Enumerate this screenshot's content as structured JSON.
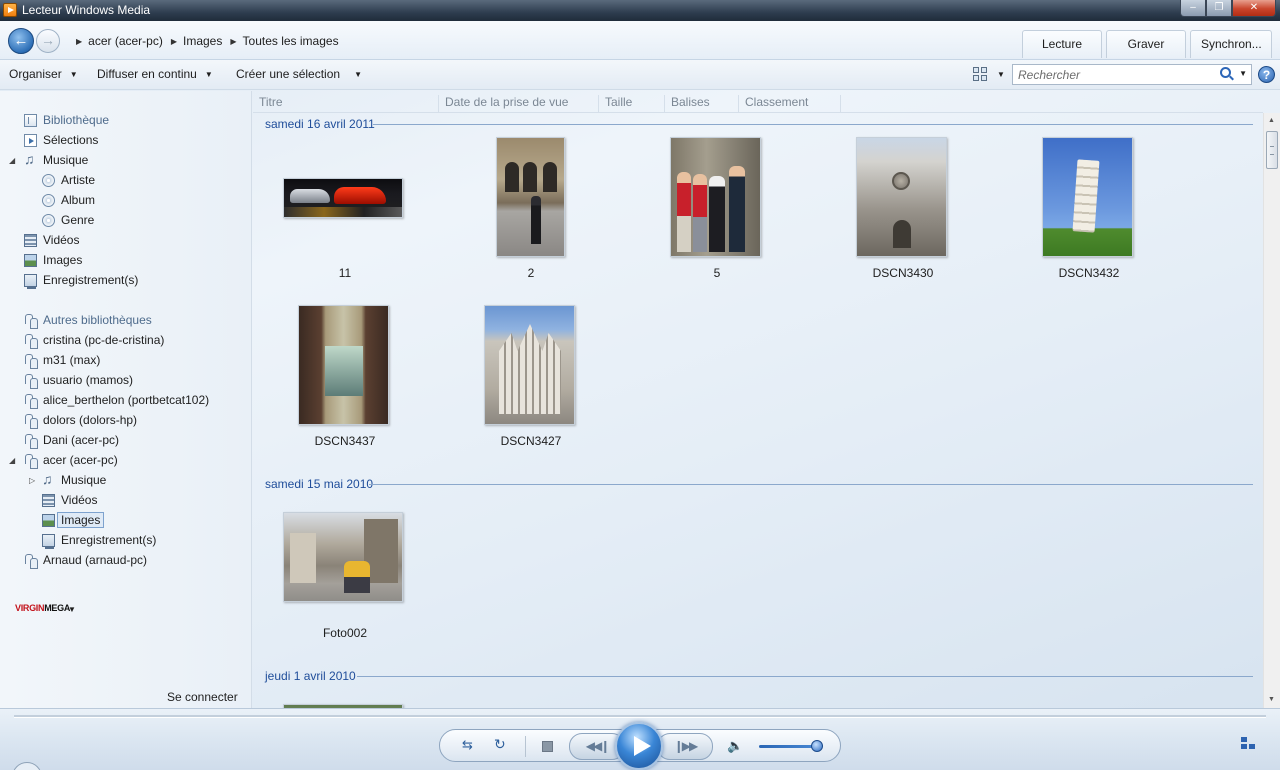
{
  "window": {
    "title": "Lecteur Windows Media"
  },
  "nav": {
    "breadcrumb": [
      "acer (acer-pc)",
      "Images",
      "Toutes les images"
    ],
    "tabs": [
      "Lecture",
      "Graver",
      "Synchron..."
    ]
  },
  "commands": {
    "organize": "Organiser",
    "stream": "Diffuser en continu",
    "create_playlist": "Créer une sélection",
    "search_placeholder": "Rechercher",
    "help": "?"
  },
  "sidebar": {
    "library": {
      "label": "Bibliothèque",
      "items": {
        "selections": "Sélections",
        "music": "Musique",
        "artist": "Artiste",
        "album": "Album",
        "genre": "Genre",
        "videos": "Vidéos",
        "images": "Images",
        "recordings": "Enregistrement(s)"
      }
    },
    "other_libraries": {
      "label": "Autres bibliothèques",
      "items": [
        "cristina (pc-de-cristina)",
        "m31 (max)",
        "usuario (mamos)",
        "alice_berthelon (portbetcat102)",
        "dolors (dolors-hp)",
        "Dani (acer-pc)",
        "acer (acer-pc)",
        "Arnaud (arnaud-pc)"
      ]
    },
    "acer_children": {
      "music": "Musique",
      "videos": "Vidéos",
      "images": "Images",
      "recordings": "Enregistrement(s)"
    },
    "store": {
      "virgin": "VIRGIN",
      "mega": "MEGA"
    },
    "connect": "Se connecter"
  },
  "columns": [
    "Titre",
    "Date de la prise de vue",
    "Taille",
    "Balises",
    "Classement"
  ],
  "groups": [
    {
      "date": "samedi 16 avril 2011",
      "items": [
        "11",
        "2",
        "5",
        "DSCN3430",
        "DSCN3432",
        "DSCN3437",
        "DSCN3427"
      ]
    },
    {
      "date": "samedi 15 mai 2010",
      "items": [
        "Foto002"
      ]
    },
    {
      "date": "jeudi 1 avril 2010",
      "items": []
    }
  ],
  "player": {
    "volume_fraction": 0.9
  }
}
